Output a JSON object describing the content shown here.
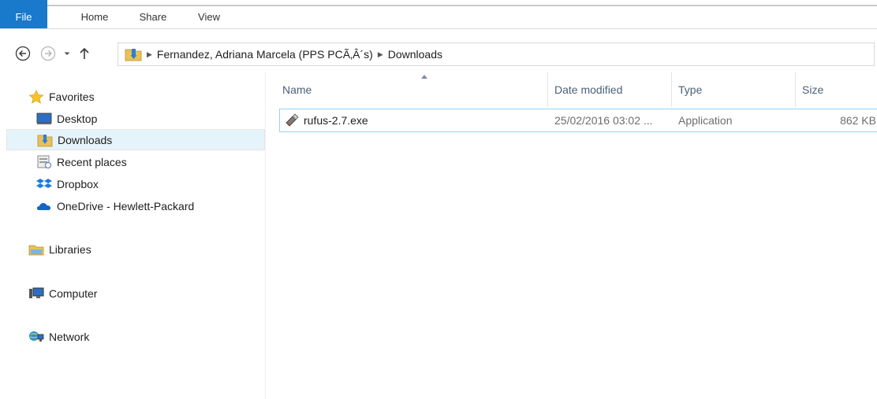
{
  "ribbon": {
    "tabs": [
      "File",
      "Home",
      "Share",
      "View"
    ]
  },
  "address": {
    "crumbs": [
      "Fernandez, Adriana Marcela (PPS PCÃ‚Â´s)",
      "Downloads"
    ]
  },
  "nav": {
    "favorites": "Favorites",
    "items": [
      "Desktop",
      "Downloads",
      "Recent places",
      "Dropbox",
      "OneDrive - Hewlett-Packard"
    ],
    "libraries": "Libraries",
    "computer": "Computer",
    "network": "Network"
  },
  "columns": {
    "name": "Name",
    "date": "Date modified",
    "type": "Type",
    "size": "Size"
  },
  "files": [
    {
      "name": "rufus-2.7.exe",
      "date": "25/02/2016 03:02 ...",
      "type": "Application",
      "size": "862 KB"
    }
  ],
  "colors": {
    "accent": "#1979ca",
    "selection_border": "#99d1ff",
    "selection_bg": "#e5f3fb"
  }
}
